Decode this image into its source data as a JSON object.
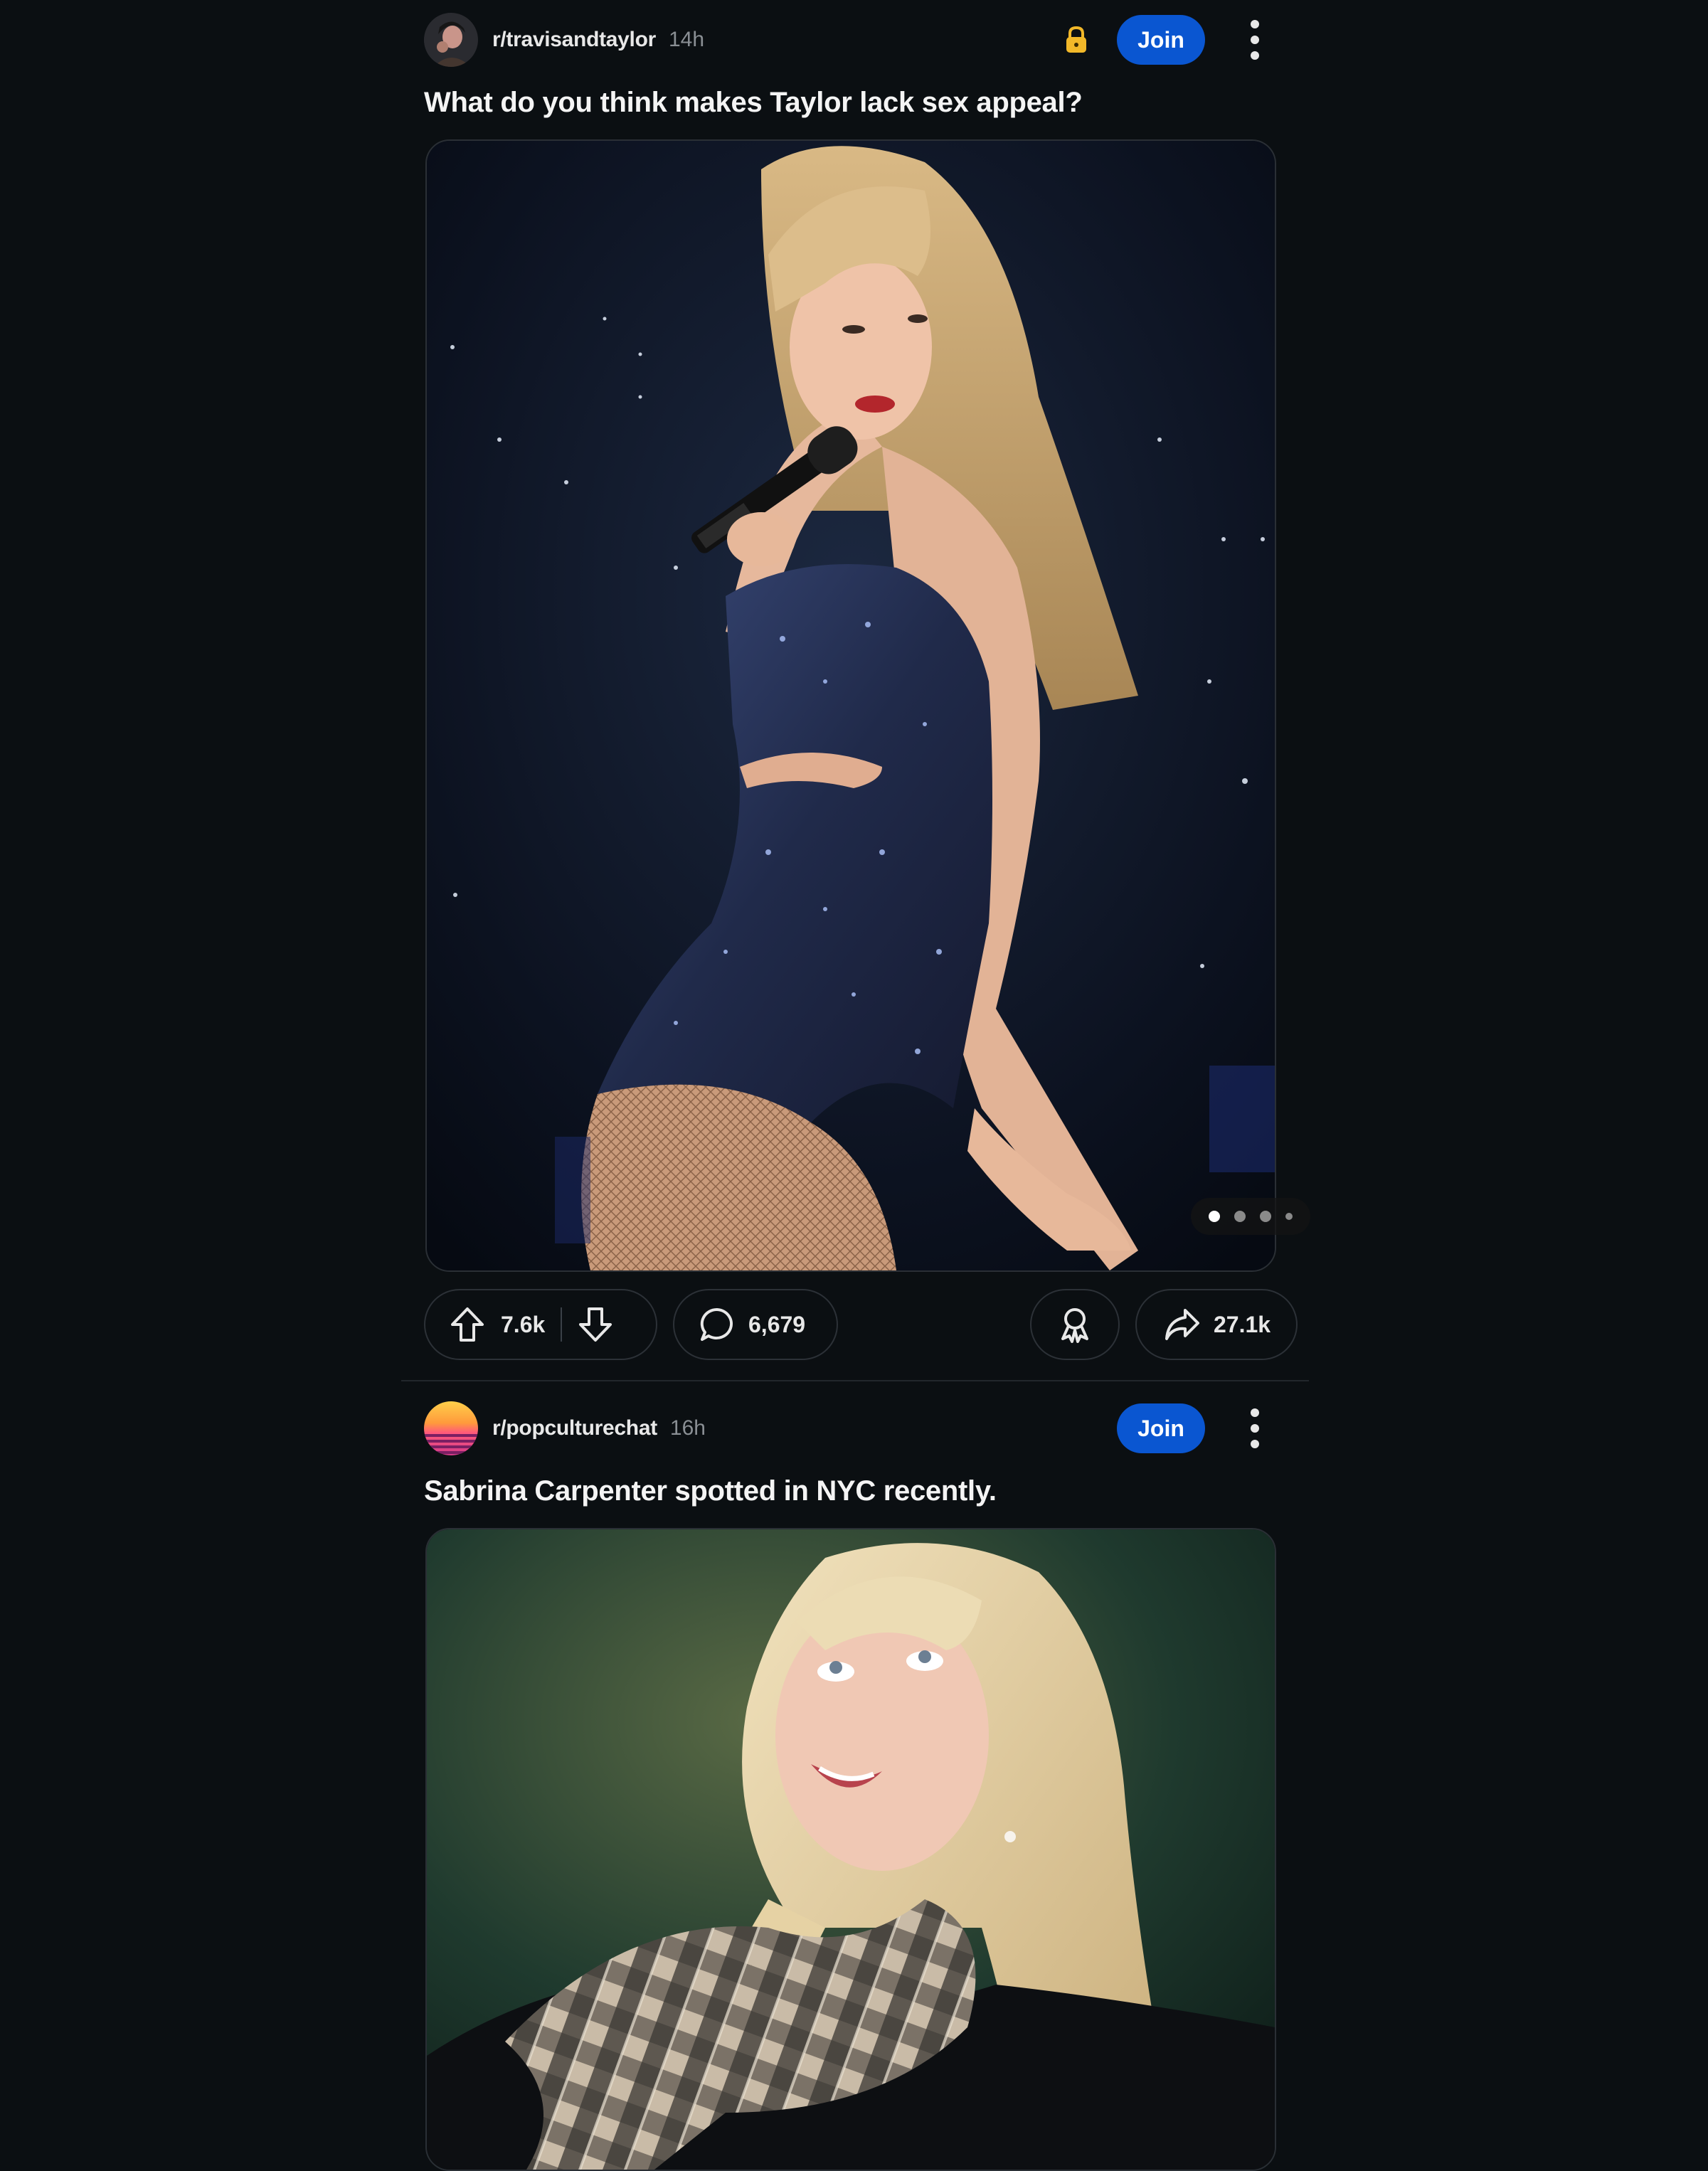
{
  "colors": {
    "background": "#0b0f12",
    "join_button": "#0a56d1",
    "lock": "#f2b829",
    "muted_text": "#8a8f94"
  },
  "posts": [
    {
      "subreddit": "r/travisandtaylor",
      "time": "14h",
      "locked": true,
      "join_label": "Join",
      "title": "What do you think makes Taylor lack sex appeal?",
      "media": {
        "type": "image-gallery",
        "subject": "performer in sparkly sequined bodysuit holding microphone on stage",
        "gallery_count": 4,
        "gallery_active_index": 1
      },
      "upvotes": "7.6k",
      "comments": "6,679",
      "shares": "27.1k",
      "icons": [
        "upvote-icon",
        "downvote-icon",
        "comment-icon",
        "award-icon",
        "share-icon",
        "more-icon",
        "lock-icon"
      ]
    },
    {
      "subreddit": "r/popculturechat",
      "time": "16h",
      "locked": false,
      "join_label": "Join",
      "title": "Sabrina Carpenter spotted in NYC recently.",
      "media": {
        "type": "image",
        "subject": "blonde woman in plaid scarf looking upward outdoors"
      },
      "icons": [
        "more-icon"
      ]
    }
  ]
}
